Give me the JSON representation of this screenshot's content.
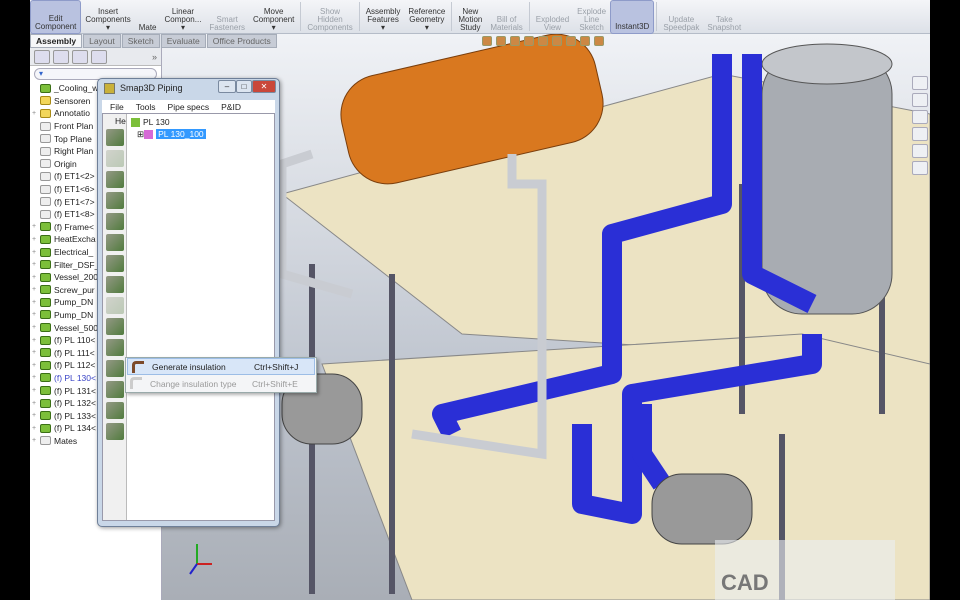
{
  "ribbon": {
    "buttons": [
      {
        "label": "Edit\nComponent",
        "state": "active"
      },
      {
        "label": "Insert\nComponents\n▾",
        "state": "normal"
      },
      {
        "label": "Mate",
        "state": "normal"
      },
      {
        "label": "Linear\nCompon...\n▾",
        "state": "normal"
      },
      {
        "label": "Smart\nFasteners",
        "state": "disabled"
      },
      {
        "label": "Move\nComponent\n▾",
        "state": "normal"
      },
      {
        "label": "Show\nHidden\nComponents",
        "state": "disabled"
      },
      {
        "label": "Assembly\nFeatures\n▾",
        "state": "normal"
      },
      {
        "label": "Reference\nGeometry\n▾",
        "state": "normal"
      },
      {
        "label": "New\nMotion\nStudy",
        "state": "normal"
      },
      {
        "label": "Bill of\nMaterials",
        "state": "disabled"
      },
      {
        "label": "Exploded\nView",
        "state": "disabled"
      },
      {
        "label": "Explode\nLine\nSketch",
        "state": "disabled"
      },
      {
        "label": "Instant3D",
        "state": "active"
      },
      {
        "label": "Update\nSpeedpak",
        "state": "disabled"
      },
      {
        "label": "Take\nSnapshot",
        "state": "disabled"
      }
    ]
  },
  "tabs": [
    {
      "label": "Assembly",
      "active": true
    },
    {
      "label": "Layout"
    },
    {
      "label": "Sketch"
    },
    {
      "label": "Evaluate"
    },
    {
      "label": "Office Products"
    }
  ],
  "tree": {
    "filter": "▾",
    "expand_label": "»",
    "items": [
      {
        "label": "_Cooling_wat",
        "icon": "assembly-icon",
        "exp": ""
      },
      {
        "label": "Sensoren",
        "icon": "sensor-icon",
        "exp": ""
      },
      {
        "label": "Annotatio",
        "icon": "annotation-icon",
        "exp": "+"
      },
      {
        "label": "Front Plan",
        "icon": "plane-icon",
        "exp": ""
      },
      {
        "label": "Top Plane",
        "icon": "plane-icon",
        "exp": ""
      },
      {
        "label": "Right Plan",
        "icon": "plane-icon",
        "exp": ""
      },
      {
        "label": "Origin",
        "icon": "origin-icon",
        "exp": ""
      },
      {
        "label": "(f) ET1<2>",
        "icon": "part-icon",
        "exp": ""
      },
      {
        "label": "(f) ET1<6>",
        "icon": "part-icon",
        "exp": ""
      },
      {
        "label": "(f) ET1<7>",
        "icon": "part-icon",
        "exp": ""
      },
      {
        "label": "(f) ET1<8>",
        "icon": "part-icon",
        "exp": ""
      },
      {
        "label": "(f) Frame<",
        "icon": "assembly-icon",
        "exp": "+"
      },
      {
        "label": "HeatExcha",
        "icon": "assembly-icon",
        "exp": "+"
      },
      {
        "label": "Electrical_",
        "icon": "assembly-icon",
        "exp": "+"
      },
      {
        "label": "Filter_DSF_",
        "icon": "assembly-icon",
        "exp": "+"
      },
      {
        "label": "Vessel_200",
        "icon": "assembly-icon",
        "exp": "+"
      },
      {
        "label": "Screw_pur",
        "icon": "assembly-icon",
        "exp": "+"
      },
      {
        "label": "Pump_DN",
        "icon": "assembly-icon",
        "exp": "+"
      },
      {
        "label": "Pump_DN",
        "icon": "assembly-icon",
        "exp": "+"
      },
      {
        "label": "Vessel_500",
        "icon": "assembly-icon",
        "exp": "+"
      },
      {
        "label": "(f) PL 110<",
        "icon": "assembly-icon",
        "exp": "+"
      },
      {
        "label": "(f) PL 111<",
        "icon": "assembly-icon",
        "exp": "+"
      },
      {
        "label": "(f) PL 112<",
        "icon": "assembly-icon",
        "exp": "+"
      },
      {
        "label": "(f) PL 130<",
        "icon": "assembly-icon",
        "exp": "+",
        "selected": true
      },
      {
        "label": "(f) PL 131<",
        "icon": "assembly-icon",
        "exp": "+"
      },
      {
        "label": "(f) PL 132<",
        "icon": "assembly-icon",
        "exp": "+"
      },
      {
        "label": "(f) PL 133<",
        "icon": "assembly-icon",
        "exp": "+"
      },
      {
        "label": "(f) PL 134<",
        "icon": "assembly-icon",
        "exp": "+"
      },
      {
        "label": "Mates",
        "icon": "mates-icon",
        "exp": "+"
      }
    ]
  },
  "dialog": {
    "title": "Smap3D Piping",
    "minimize": "–",
    "maximize": "□",
    "close": "✕",
    "menu": [
      "File",
      "Tools",
      "Pipe specs",
      "P&ID"
    ],
    "help_fragment": "He",
    "tree": [
      {
        "label": "PL 130",
        "selected": false
      },
      {
        "label": "PL 130_100",
        "selected": true
      }
    ]
  },
  "context_menu": [
    {
      "label": "Generate insulation",
      "shortcut": "Ctrl+Shift+J",
      "enabled": true
    },
    {
      "label": "Change insulation type",
      "shortcut": "Ctrl+Shift+E",
      "enabled": false
    }
  ],
  "watermark": "CAD",
  "colors": {
    "pipe": "#2a2fd6",
    "tank": "#d9781f",
    "vessel": "#a8acb2",
    "platform": "#ece3c3"
  }
}
